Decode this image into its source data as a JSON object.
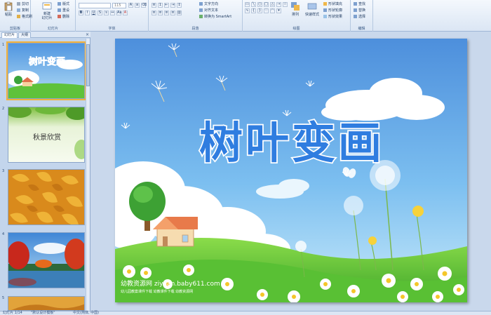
{
  "ribbon": {
    "clipboard": {
      "paste": "粘贴",
      "cut": "剪切",
      "copy": "复制",
      "format_painter": "格式刷",
      "label": "剪贴板"
    },
    "slides": {
      "new_slide": "新建\n幻灯片",
      "layout": "版式",
      "reset": "重设",
      "delete": "删除",
      "label": "幻灯片"
    },
    "font": {
      "font_name": "",
      "font_size": "115",
      "label": "字体"
    },
    "paragraph": {
      "text_direction": "文字方向",
      "align_text": "对齐文本",
      "smartart": "转换为 SmartArt",
      "label": "段落"
    },
    "drawing": {
      "arrange": "排列",
      "quick_styles": "快速样式",
      "shape_fill": "形状填充",
      "shape_outline": "形状轮廓",
      "shape_effects": "形状效果",
      "label": "绘图"
    },
    "editing": {
      "find": "查找",
      "replace": "替换",
      "select": "选择",
      "label": "编辑"
    }
  },
  "pane": {
    "tab_slides": "幻灯片",
    "tab_outline": "大纲",
    "close": "×"
  },
  "thumbs": [
    {
      "num": "1",
      "title": "树叶变画"
    },
    {
      "num": "2",
      "title": "秋景欣赏"
    },
    {
      "num": "3",
      "title": ""
    },
    {
      "num": "4",
      "title": ""
    },
    {
      "num": "5",
      "title": ""
    }
  ],
  "slide": {
    "title": "树叶变画",
    "watermark": "幼教资源网 ziyuan.baby611.com",
    "watermark_small": "幼儿园教案课件下载 幼教课件下载 幼教资源网"
  },
  "status": {
    "slide_count": "幻灯片 1/14",
    "theme": "\"默认设计模板\"",
    "language": "中文(简体, 中国)"
  },
  "colors": {
    "sky_top": "#5f9fe2",
    "sky_bottom": "#a9d8f5",
    "title_fill": "#2f7de0",
    "grass": "#6ac93b",
    "accent": "#f2b23a"
  }
}
